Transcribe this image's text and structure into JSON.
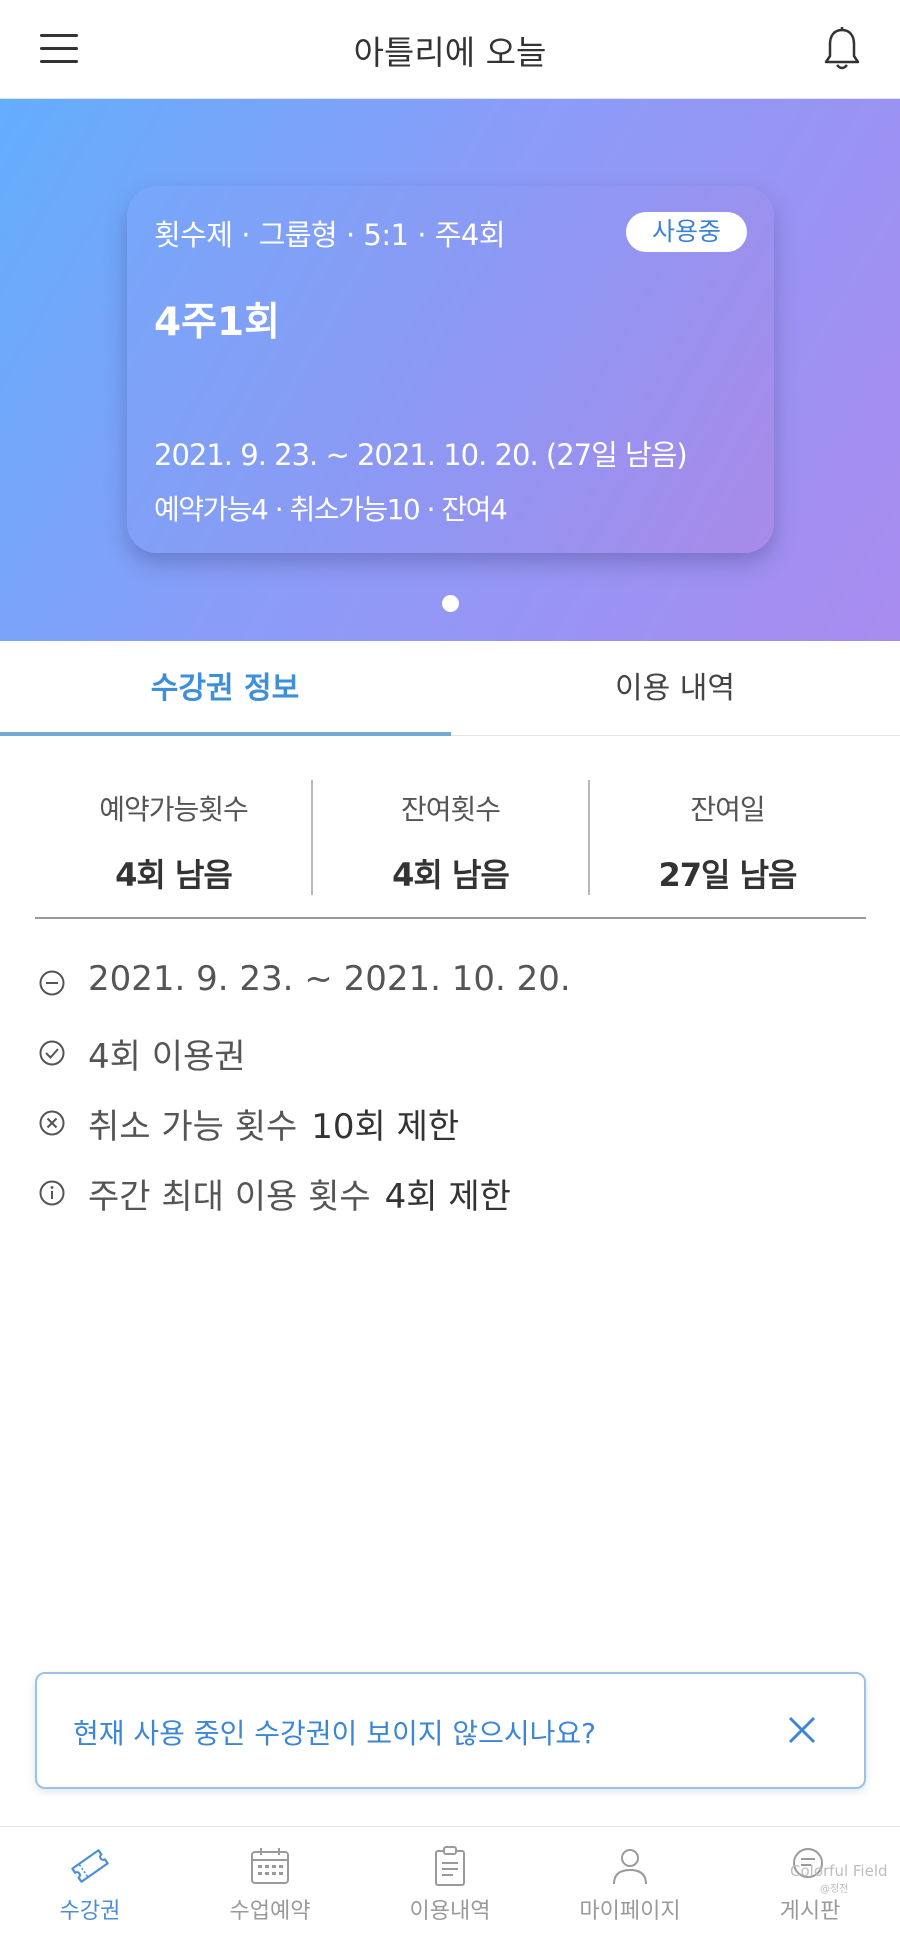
{
  "header": {
    "title": "아틀리에 오늘"
  },
  "ticket": {
    "meta": "횟수제 · 그룹형 · 5:1 · 주4회",
    "status": "사용중",
    "name": "4주1회",
    "period": "2021. 9. 23. ~ 2021. 10. 20. (27일 남음)",
    "counts": "예약가능4 · 취소가능10 · 잔여4"
  },
  "tabs": [
    "수강권 정보",
    "이용 내역"
  ],
  "stats": [
    {
      "label": "예약가능횟수",
      "value": "4회 남음"
    },
    {
      "label": "잔여횟수",
      "value": "4회 남음"
    },
    {
      "label": "잔여일",
      "value": "27일 남음"
    }
  ],
  "info": {
    "period": "2021. 9. 23. ~ 2021. 10. 20.",
    "usage": "4회 이용권",
    "cancel_label": "취소 가능 횟수",
    "cancel_value": "10회 제한",
    "weekly_label": "주간 최대 이용 횟수",
    "weekly_value": "4회 제한"
  },
  "notice": {
    "text": "현재 사용 중인 수강권이 보이지 않으시나요?"
  },
  "nav": [
    {
      "label": "수강권",
      "icon": "ticket-icon",
      "active": true
    },
    {
      "label": "수업예약",
      "icon": "calendar-icon",
      "active": false
    },
    {
      "label": "이용내역",
      "icon": "clipboard-icon",
      "active": false
    },
    {
      "label": "마이페이지",
      "icon": "user-icon",
      "active": false
    },
    {
      "label": "게시판",
      "icon": "chat-icon",
      "active": false
    }
  ],
  "watermark": {
    "line1": "Colorful Field",
    "line2": "@정전"
  },
  "colors": {
    "accent": "#3d8fd9",
    "hero_start": "#63aefc",
    "hero_end": "#a98bef",
    "notice_border": "#9cc1e6"
  }
}
